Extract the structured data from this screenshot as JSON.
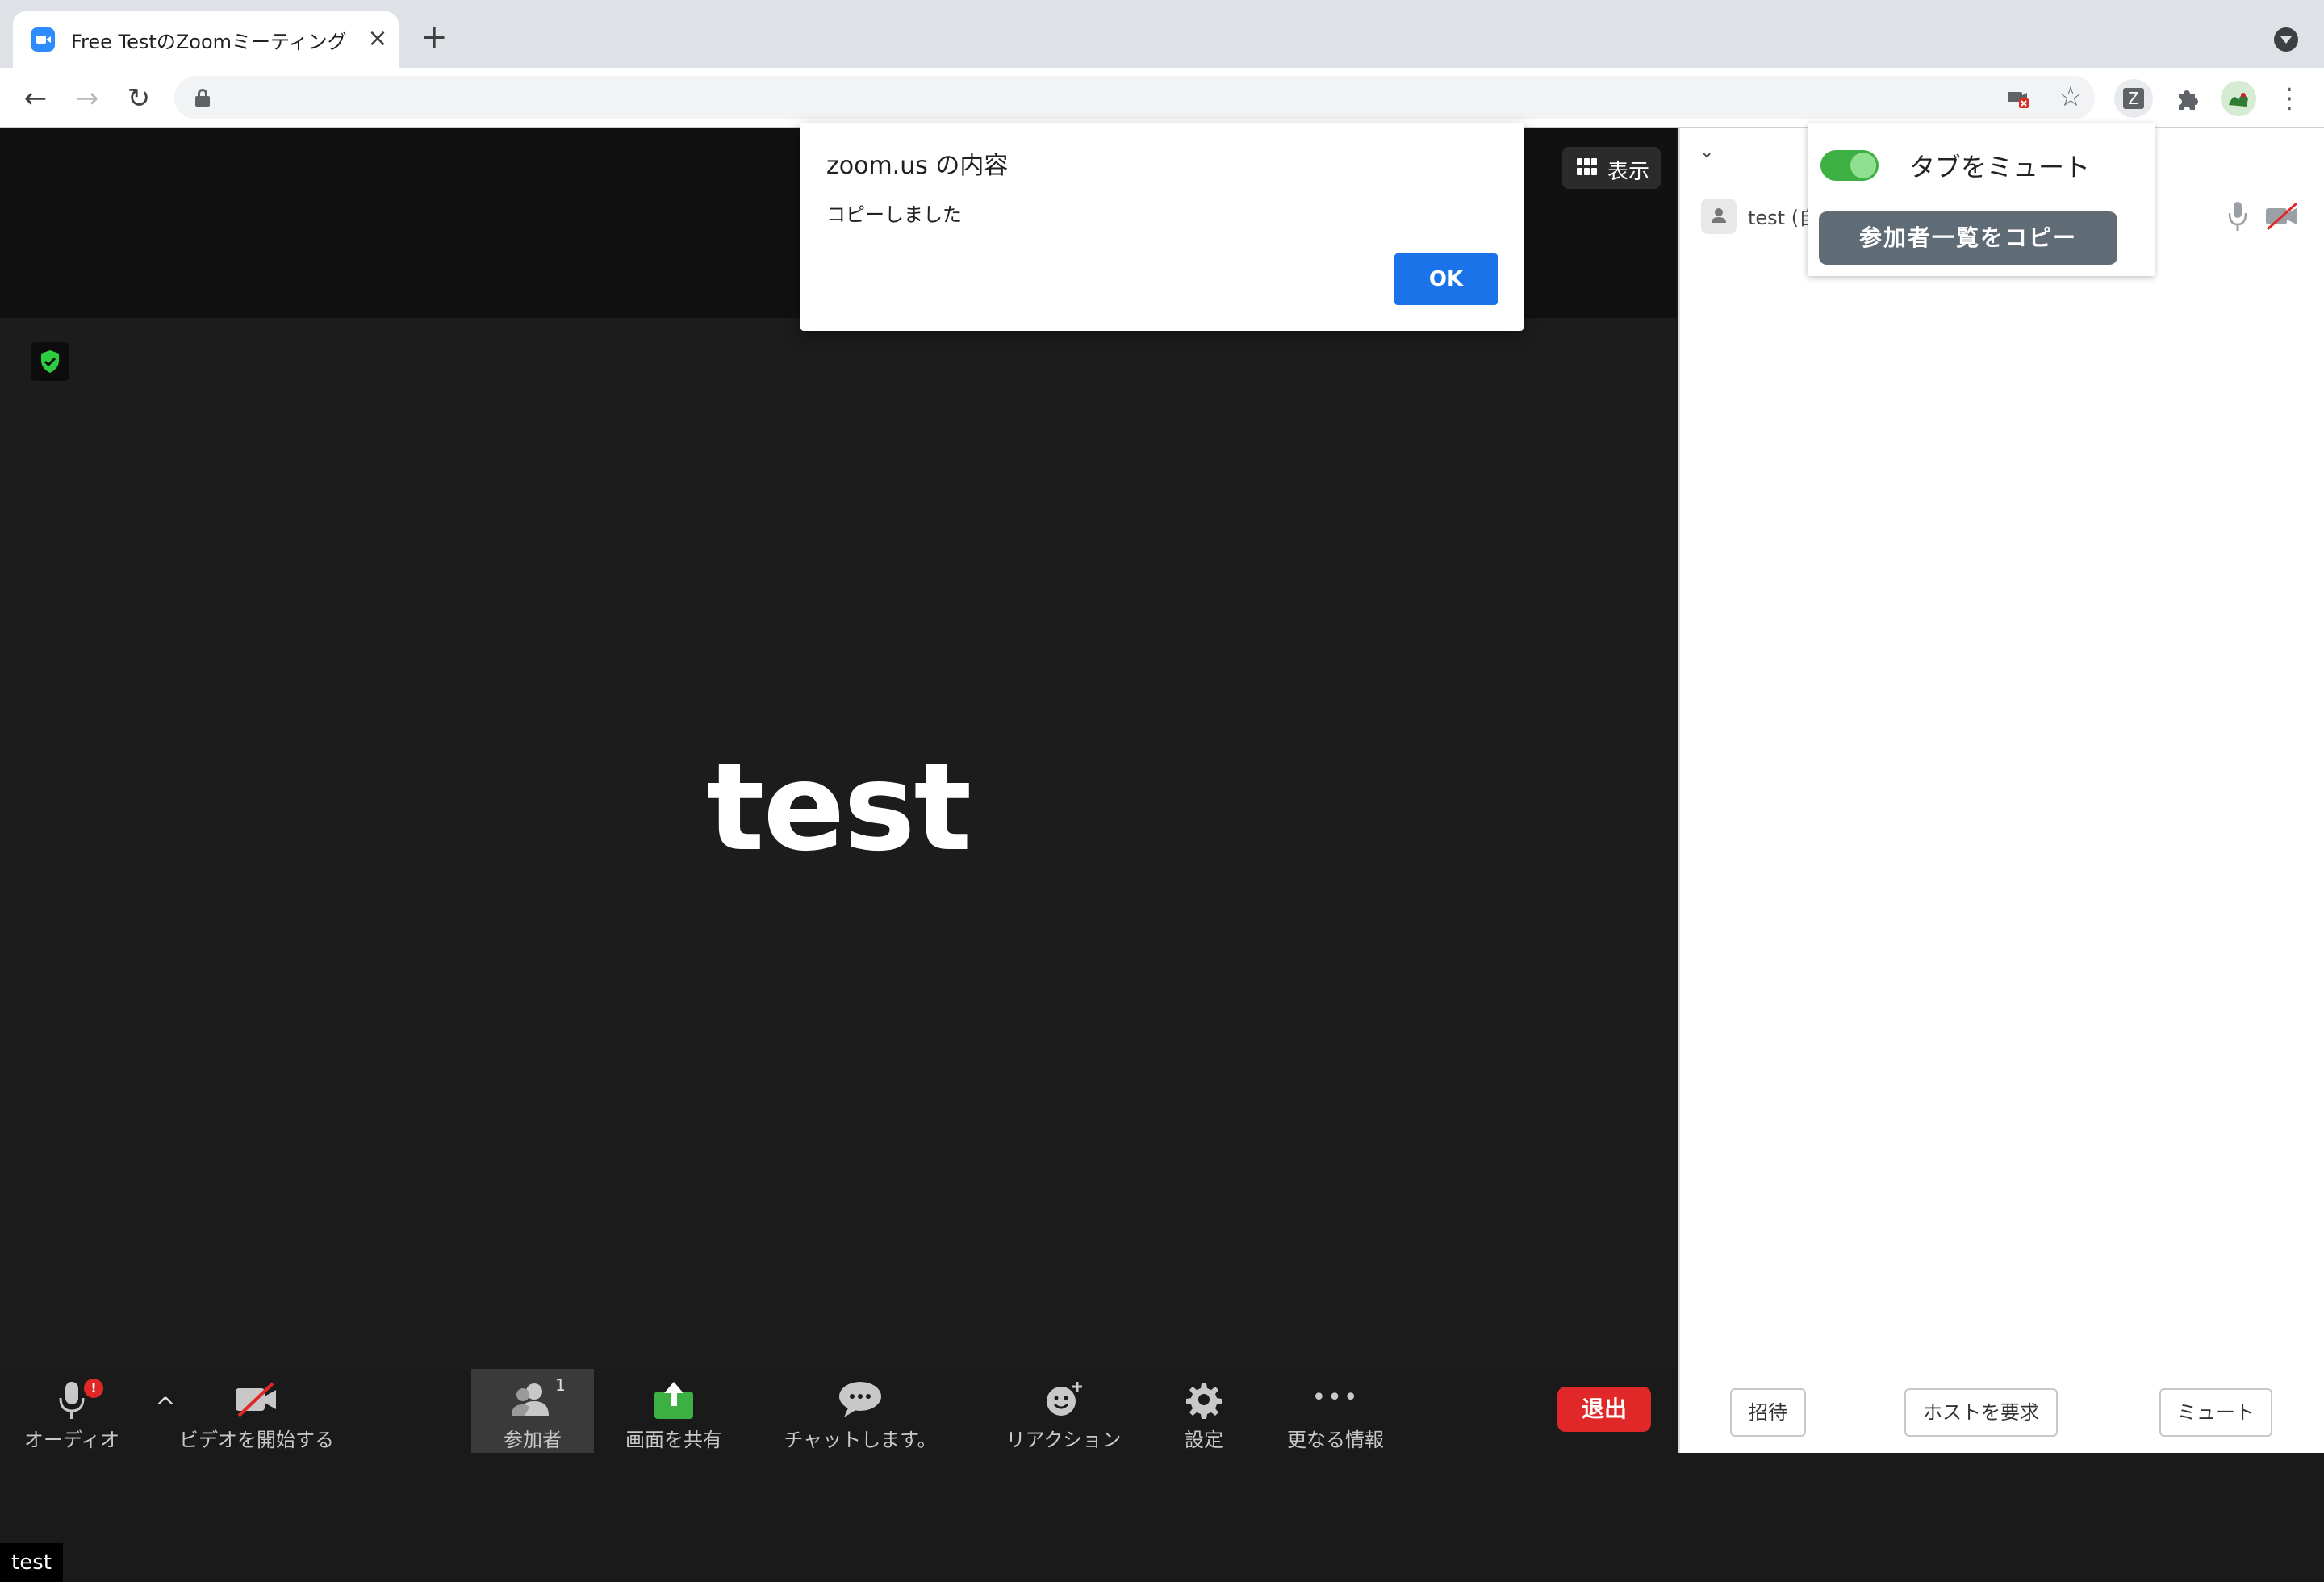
{
  "browser": {
    "tab_title": "Free TestのZoomミーティング",
    "tab_close": "×",
    "new_tab": "+",
    "nav": {
      "back": "←",
      "forward": "→",
      "reload": "↻"
    },
    "star": "☆",
    "extension_letter": "Z",
    "menu": "⋮"
  },
  "meeting": {
    "view_button_label": "表示",
    "participant_display_name": "test",
    "video_name_label": "test"
  },
  "toolbar": {
    "audio_label": "オーディオ",
    "audio_alert": "!",
    "audio_chevron": "^",
    "video_label": "ビデオを開始する",
    "participants_label": "参加者",
    "participants_count": "1",
    "share_label": "画面を共有",
    "chat_label": "チャットします。",
    "reactions_label": "リアクション",
    "settings_label": "設定",
    "more_label": "更なる情報",
    "more_dots": "•••",
    "leave_label": "退出"
  },
  "side_panel": {
    "chevron": "⌄",
    "participant_name": "test (自",
    "invite_button": "招待",
    "claim_host_button": "ホストを要求",
    "mute_button": "ミュート"
  },
  "extension_popup": {
    "toggle_label": "タブをミュート",
    "toggle_on": true,
    "copy_button": "参加者一覧をコピー"
  },
  "alert": {
    "title": "zoom.us の内容",
    "message": "コピーしました",
    "ok_button": "OK"
  },
  "colors": {
    "zoom_blue": "#2d8cff",
    "leave_red": "#e02828",
    "share_green": "#3cb043",
    "chrome_blue": "#1a73e8"
  }
}
